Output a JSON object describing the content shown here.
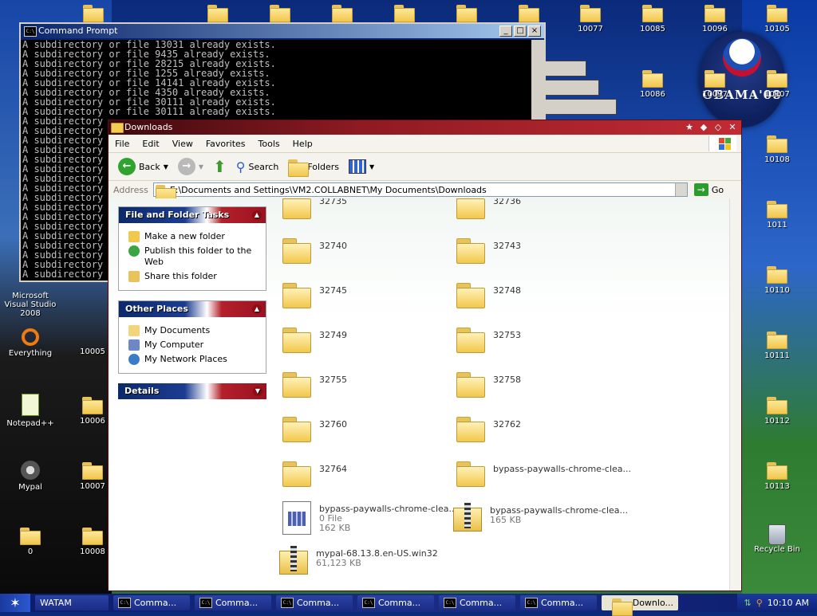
{
  "desktop": {
    "icons_right": [
      {
        "label": "10077"
      },
      {
        "label": "10085"
      },
      {
        "label": "10096"
      },
      {
        "label": "10105"
      },
      {
        "label": "10086"
      },
      {
        "label": "10097"
      },
      {
        "label": "10107"
      },
      {
        "label": "10108"
      },
      {
        "label": "1011"
      },
      {
        "label": "10110"
      },
      {
        "label": "10111"
      },
      {
        "label": "10112"
      },
      {
        "label": "10113"
      },
      {
        "label": "Recycle Bin"
      }
    ],
    "icons_left": [
      {
        "label": "Microsoft Visual Studio 2008"
      },
      {
        "label": "Everything"
      },
      {
        "label": "10005"
      },
      {
        "label": "Notepad++"
      },
      {
        "label": "10006"
      },
      {
        "label": "Mypal"
      },
      {
        "label": "10007"
      },
      {
        "label": "0"
      },
      {
        "label": "10008"
      }
    ],
    "wallpaper_text": "OBAMA'08"
  },
  "cmd": {
    "title": "Command Prompt",
    "lines": [
      "A subdirectory or file 13031 already exists.",
      "A subdirectory or file 9435 already exists.",
      "A subdirectory or file 28215 already exists.",
      "A subdirectory or file 1255 already exists.",
      "A subdirectory or file 14141 already exists.",
      "A subdirectory or file 4350 already exists.",
      "A subdirectory or file 30111 already exists.",
      "A subdirectory or file 30111 already exists.",
      "A subdirectory",
      "A subdirectory",
      "A subdirectory",
      "A subdirectory",
      "A subdirectory",
      "A subdirectory",
      "A subdirectory",
      "A subdirectory",
      "A subdirectory",
      "A subdirectory",
      "A subdirectory",
      "A subdirectory",
      "A subdirectory",
      "A subdirectory",
      "A subdirectory",
      "A subdirectory",
      "A subdirectory"
    ]
  },
  "explorer": {
    "title": "Downloads",
    "menu": [
      "File",
      "Edit",
      "View",
      "Favorites",
      "Tools",
      "Help"
    ],
    "toolbar": {
      "back": "Back",
      "search": "Search",
      "folders": "Folders"
    },
    "address": {
      "label": "Address",
      "path": "E:\\Documents and Settings\\VM2.COLLABNET\\My Documents\\Downloads",
      "go": "Go"
    },
    "tasks": {
      "file_folder": {
        "title": "File and Folder Tasks",
        "items": [
          "Make a new folder",
          "Publish this folder to the Web",
          "Share this folder"
        ]
      },
      "other_places": {
        "title": "Other Places",
        "items": [
          "My Documents",
          "My Computer",
          "My Network Places"
        ]
      },
      "details": {
        "title": "Details"
      }
    },
    "files": [
      {
        "name": "32735"
      },
      {
        "name": "32736"
      },
      {
        "name": "32740"
      },
      {
        "name": "32743"
      },
      {
        "name": "32745"
      },
      {
        "name": "32748"
      },
      {
        "name": "32749"
      },
      {
        "name": "32753"
      },
      {
        "name": "32755"
      },
      {
        "name": "32758"
      },
      {
        "name": "32760"
      },
      {
        "name": "32762"
      },
      {
        "name": "32764"
      },
      {
        "name": "bypass-paywalls-chrome-clea..."
      },
      {
        "name": "bypass-paywalls-chrome-clea...",
        "type": "0 File",
        "size": "162 KB"
      },
      {
        "name": "bypass-paywalls-chrome-clea...",
        "size": "165 KB"
      },
      {
        "name": "mypal-68.13.8.en-US.win32",
        "size": "61,123 KB"
      }
    ]
  },
  "taskbar": {
    "buttons": [
      "WATAM",
      "Comma...",
      "Comma...",
      "Comma...",
      "Comma...",
      "Comma...",
      "Comma...",
      "Downlo..."
    ],
    "clock": "10:10 AM"
  }
}
